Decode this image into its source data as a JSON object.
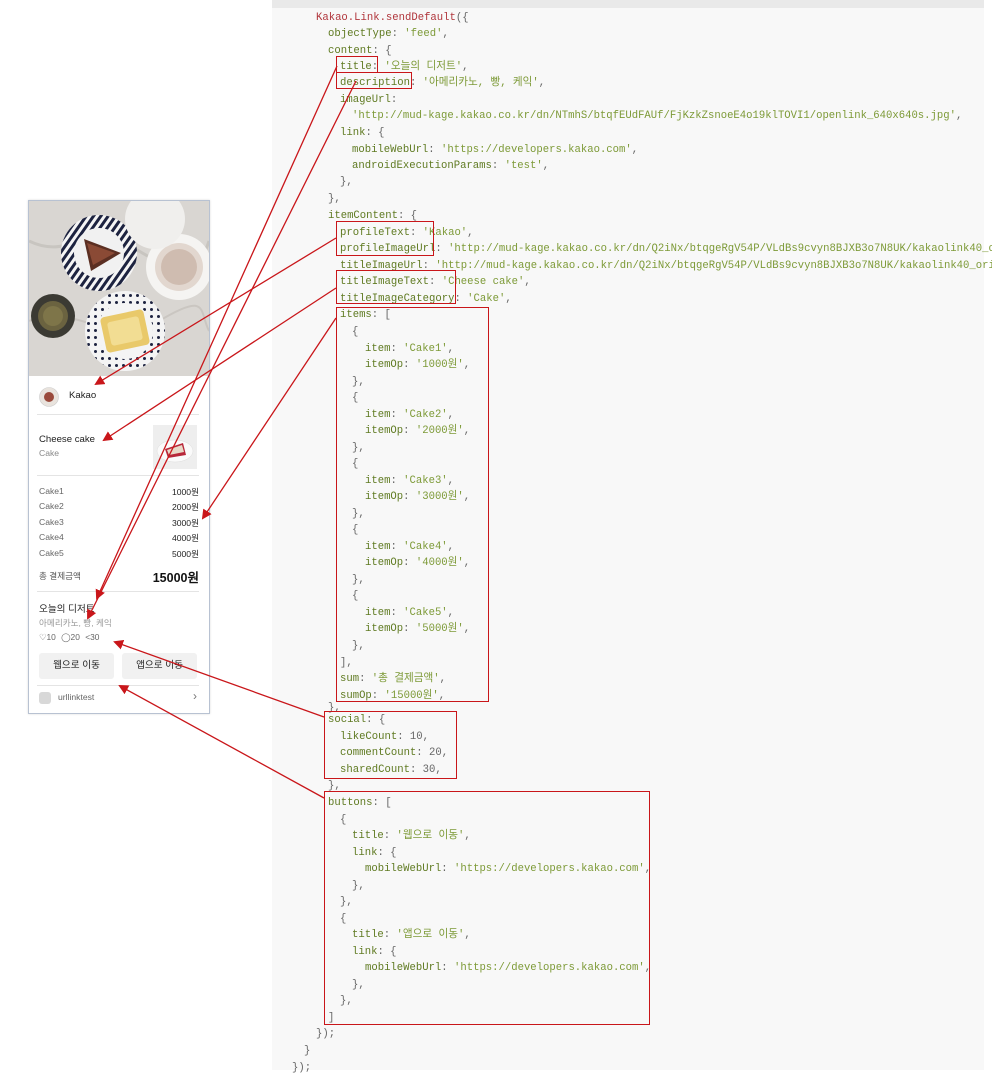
{
  "code": {
    "lines": [
      [
        [
          "fn",
          "Kakao.Link.sendDefault"
        ],
        [
          "punc",
          "({"
        ]
      ],
      [
        [
          "key",
          "objectType"
        ],
        [
          "punc",
          ": "
        ],
        [
          "str",
          "'feed'"
        ],
        [
          "punc",
          ","
        ]
      ],
      [
        [
          "key",
          "content"
        ],
        [
          "punc",
          ": {"
        ]
      ],
      [
        [
          "key",
          "title"
        ],
        [
          "punc",
          ": "
        ],
        [
          "str",
          "'오늘의 디저트'"
        ],
        [
          "punc",
          ","
        ]
      ],
      [
        [
          "key",
          "description"
        ],
        [
          "punc",
          ": "
        ],
        [
          "str",
          "'아메리카노, 빵, 케익'"
        ],
        [
          "punc",
          ","
        ]
      ],
      [
        [
          "key",
          "imageUrl"
        ],
        [
          "punc",
          ":"
        ]
      ],
      [
        [
          "str",
          "'http://mud-kage.kakao.co.kr/dn/NTmhS/btqfEUdFAUf/FjKzkZsnoeE4o19klTOVI1/openlink_640x640s.jpg'"
        ],
        [
          "punc",
          ","
        ]
      ],
      [
        [
          "key",
          "link"
        ],
        [
          "punc",
          ": {"
        ]
      ],
      [
        [
          "key",
          "mobileWebUrl"
        ],
        [
          "punc",
          ": "
        ],
        [
          "str",
          "'https://developers.kakao.com'"
        ],
        [
          "punc",
          ","
        ]
      ],
      [
        [
          "key",
          "androidExecutionParams"
        ],
        [
          "punc",
          ": "
        ],
        [
          "str",
          "'test'"
        ],
        [
          "punc",
          ","
        ]
      ],
      [
        [
          "punc",
          "},"
        ]
      ],
      [
        [
          "punc",
          "},"
        ]
      ],
      [
        [
          "key",
          "itemContent"
        ],
        [
          "punc",
          ": {"
        ]
      ],
      [
        [
          "key",
          "profileText"
        ],
        [
          "punc",
          ": "
        ],
        [
          "str",
          "'Kakao'"
        ],
        [
          "punc",
          ","
        ]
      ],
      [
        [
          "key",
          "profileImageUrl"
        ],
        [
          "punc",
          ": "
        ],
        [
          "str",
          "'http://mud-kage.kakao.co.kr/dn/Q2iNx/btqgeRgV54P/VLdBs9cvyn8BJXB3o7N8UK/kakaolink40_orig"
        ]
      ],
      [
        [
          "key",
          "titleImageUrl"
        ],
        [
          "punc",
          ": "
        ],
        [
          "str",
          "'http://mud-kage.kakao.co.kr/dn/Q2iNx/btqgeRgV54P/VLdBs9cvyn8BJXB3o7N8UK/kakaolink40_origina"
        ]
      ],
      [
        [
          "key",
          "titleImageText"
        ],
        [
          "punc",
          ": "
        ],
        [
          "str",
          "'Cheese cake'"
        ],
        [
          "punc",
          ","
        ]
      ],
      [
        [
          "key",
          "titleImageCategory"
        ],
        [
          "punc",
          ": "
        ],
        [
          "str",
          "'Cake'"
        ],
        [
          "punc",
          ","
        ]
      ],
      [
        [
          "key",
          "items"
        ],
        [
          "punc",
          ": ["
        ]
      ],
      [
        [
          "punc",
          "{"
        ]
      ],
      [
        [
          "key",
          "item"
        ],
        [
          "punc",
          ": "
        ],
        [
          "str",
          "'Cake1'"
        ],
        [
          "punc",
          ","
        ]
      ],
      [
        [
          "key",
          "itemOp"
        ],
        [
          "punc",
          ": "
        ],
        [
          "str",
          "'1000원'"
        ],
        [
          "punc",
          ","
        ]
      ],
      [
        [
          "punc",
          "},"
        ]
      ],
      [
        [
          "punc",
          "{"
        ]
      ],
      [
        [
          "key",
          "item"
        ],
        [
          "punc",
          ": "
        ],
        [
          "str",
          "'Cake2'"
        ],
        [
          "punc",
          ","
        ]
      ],
      [
        [
          "key",
          "itemOp"
        ],
        [
          "punc",
          ": "
        ],
        [
          "str",
          "'2000원'"
        ],
        [
          "punc",
          ","
        ]
      ],
      [
        [
          "punc",
          "},"
        ]
      ],
      [
        [
          "punc",
          "{"
        ]
      ],
      [
        [
          "key",
          "item"
        ],
        [
          "punc",
          ": "
        ],
        [
          "str",
          "'Cake3'"
        ],
        [
          "punc",
          ","
        ]
      ],
      [
        [
          "key",
          "itemOp"
        ],
        [
          "punc",
          ": "
        ],
        [
          "str",
          "'3000원'"
        ],
        [
          "punc",
          ","
        ]
      ],
      [
        [
          "punc",
          "},"
        ]
      ],
      [
        [
          "punc",
          "{"
        ]
      ],
      [
        [
          "key",
          "item"
        ],
        [
          "punc",
          ": "
        ],
        [
          "str",
          "'Cake4'"
        ],
        [
          "punc",
          ","
        ]
      ],
      [
        [
          "key",
          "itemOp"
        ],
        [
          "punc",
          ": "
        ],
        [
          "str",
          "'4000원'"
        ],
        [
          "punc",
          ","
        ]
      ],
      [
        [
          "punc",
          "},"
        ]
      ],
      [
        [
          "punc",
          "{"
        ]
      ],
      [
        [
          "key",
          "item"
        ],
        [
          "punc",
          ": "
        ],
        [
          "str",
          "'Cake5'"
        ],
        [
          "punc",
          ","
        ]
      ],
      [
        [
          "key",
          "itemOp"
        ],
        [
          "punc",
          ": "
        ],
        [
          "str",
          "'5000원'"
        ],
        [
          "punc",
          ","
        ]
      ],
      [
        [
          "punc",
          "},"
        ]
      ],
      [
        [
          "punc",
          "],"
        ]
      ],
      [
        [
          "key",
          "sum"
        ],
        [
          "punc",
          ": "
        ],
        [
          "str",
          "'총 결제금액'"
        ],
        [
          "punc",
          ","
        ]
      ],
      [
        [
          "key",
          "sumOp"
        ],
        [
          "punc",
          ": "
        ],
        [
          "str",
          "'15000원'"
        ],
        [
          "punc",
          ","
        ]
      ],
      [
        [
          "punc",
          "},"
        ]
      ],
      [
        [
          "key",
          "social"
        ],
        [
          "punc",
          ": {"
        ]
      ],
      [
        [
          "key",
          "likeCount"
        ],
        [
          "punc",
          ": 10,"
        ]
      ],
      [
        [
          "key",
          "commentCount"
        ],
        [
          "punc",
          ": 20,"
        ]
      ],
      [
        [
          "key",
          "sharedCount"
        ],
        [
          "punc",
          ": 30,"
        ]
      ],
      [
        [
          "punc",
          "},"
        ]
      ],
      [
        [
          "key",
          "buttons"
        ],
        [
          "punc",
          ": ["
        ]
      ],
      [
        [
          "punc",
          "{"
        ]
      ],
      [
        [
          "key",
          "title"
        ],
        [
          "punc",
          ": "
        ],
        [
          "str",
          "'웹으로 이동'"
        ],
        [
          "punc",
          ","
        ]
      ],
      [
        [
          "key",
          "link"
        ],
        [
          "punc",
          ": {"
        ]
      ],
      [
        [
          "key",
          "mobileWebUrl"
        ],
        [
          "punc",
          ": "
        ],
        [
          "str",
          "'https://developers.kakao.com'"
        ],
        [
          "punc",
          ","
        ]
      ],
      [
        [
          "punc",
          "},"
        ]
      ],
      [
        [
          "punc",
          "},"
        ]
      ],
      [
        [
          "punc",
          "{"
        ]
      ],
      [
        [
          "key",
          "title"
        ],
        [
          "punc",
          ": "
        ],
        [
          "str",
          "'앱으로 이동'"
        ],
        [
          "punc",
          ","
        ]
      ],
      [
        [
          "key",
          "link"
        ],
        [
          "punc",
          ": {"
        ]
      ],
      [
        [
          "key",
          "mobileWebUrl"
        ],
        [
          "punc",
          ": "
        ],
        [
          "str",
          "'https://developers.kakao.com'"
        ],
        [
          "punc",
          ","
        ]
      ],
      [
        [
          "punc",
          "},"
        ]
      ],
      [
        [
          "punc",
          "},"
        ]
      ],
      [
        [
          "punc",
          "]"
        ]
      ],
      [
        [
          "punc",
          "});"
        ]
      ],
      [
        [
          "punc",
          "}"
        ]
      ],
      [
        [
          "punc",
          "});"
        ]
      ]
    ]
  },
  "card": {
    "profile_text": "Kakao",
    "title_image_text": "Cheese cake",
    "title_image_category": "Cake",
    "items": [
      {
        "item": "Cake1",
        "itemOp": "1000원"
      },
      {
        "item": "Cake2",
        "itemOp": "2000원"
      },
      {
        "item": "Cake3",
        "itemOp": "3000원"
      },
      {
        "item": "Cake4",
        "itemOp": "4000원"
      },
      {
        "item": "Cake5",
        "itemOp": "5000원"
      }
    ],
    "sum_label": "총 결제금액",
    "sum_value": "15000원",
    "title": "오늘의 디저트",
    "description": "아메리카노, 빵, 케익",
    "social": {
      "likes": "10",
      "comments": "20",
      "shares": "30"
    },
    "buttons": [
      "웹으로 이동",
      "앱으로 이동"
    ],
    "footer_text": "urllinktest",
    "footer_chevron": "›"
  },
  "colors": {
    "arrow": "#c9161a",
    "box": "#c9161a",
    "code_bg": "#f8f8f8",
    "string": "#7d9a37",
    "key": "#5f7a21",
    "function": "#b0353b"
  }
}
